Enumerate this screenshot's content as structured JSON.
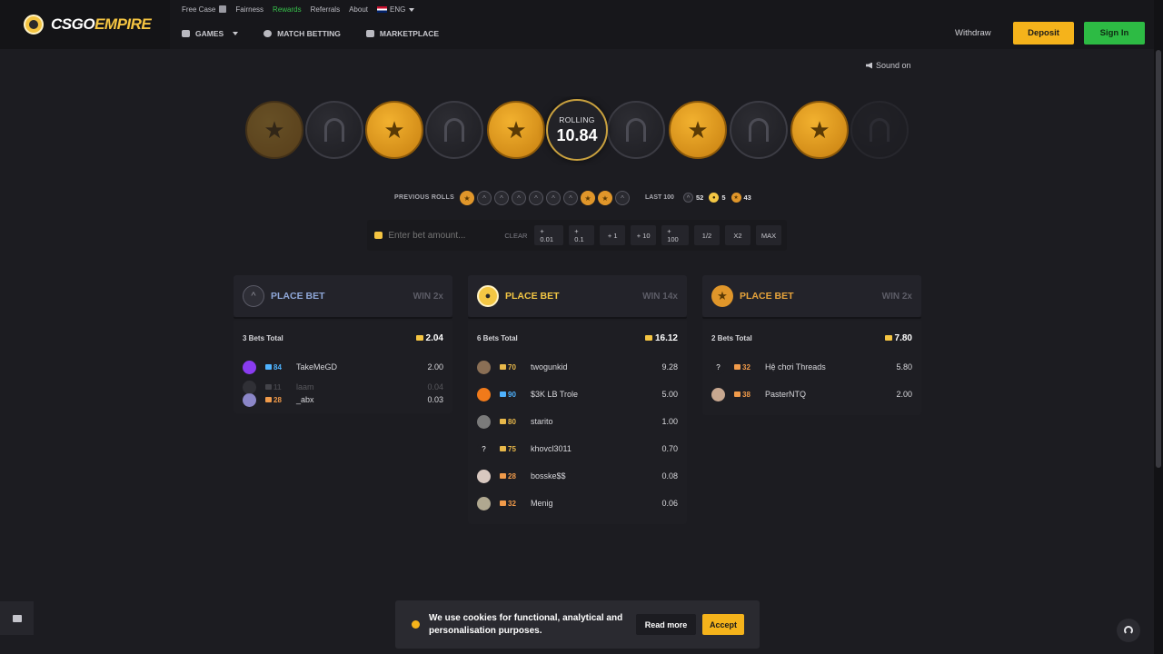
{
  "header": {
    "logo_white": "CSGO",
    "logo_yellow": "EMPIRE",
    "top_links": [
      "Free Case",
      "Fairness",
      "Rewards",
      "Referrals",
      "About"
    ],
    "language": "ENG",
    "nav": [
      "GAMES",
      "MATCH BETTING",
      "MARKETPLACE"
    ],
    "withdraw": "Withdraw",
    "deposit": "Deposit",
    "sign_in": "Sign In"
  },
  "sound": "Sound on",
  "roulette": {
    "label": "ROLLING",
    "value": "10.84",
    "strip": [
      "t",
      "ct",
      "t",
      "ct",
      "t",
      "rolling",
      "ct",
      "t",
      "ct",
      "t",
      "ct"
    ]
  },
  "previous_rolls": {
    "label": "PREVIOUS ROLLS",
    "items": [
      "t",
      "ct",
      "ct",
      "ct",
      "ct",
      "ct",
      "ct",
      "t",
      "t",
      "ct"
    ]
  },
  "last100": {
    "label": "LAST 100",
    "ct": "52",
    "bonus": "5",
    "t": "43"
  },
  "bet_input": {
    "placeholder": "Enter bet amount...",
    "clear": "CLEAR",
    "chips": [
      "+ 0.01",
      "+ 0.1",
      "+ 1",
      "+ 10",
      "+ 100",
      "1/2",
      "X2",
      "MAX"
    ]
  },
  "columns": [
    {
      "type": "ct",
      "place": "PLACE BET",
      "win": "WIN 2x",
      "total_label": "3 Bets Total",
      "total": "2.04",
      "players": [
        {
          "level": "84",
          "name": "TakeMeGD",
          "amount": "2.00",
          "state": "normal",
          "avatar": "#8a3cf0",
          "level_color": "#4fb3ff"
        },
        {
          "level": "11",
          "name": "laam",
          "amount": "0.04",
          "state": "fade",
          "avatar": "#5a5a62",
          "level_color": "#9a9aa2"
        },
        {
          "level": "28",
          "name": "_abx",
          "amount": "0.03",
          "state": "tight",
          "avatar": "#8b86c8",
          "level_color": "#f09a4a"
        }
      ]
    },
    {
      "type": "bonus",
      "place": "PLACE BET",
      "win": "WIN 14x",
      "total_label": "6 Bets Total",
      "total": "16.12",
      "players": [
        {
          "level": "70",
          "name": "twogunkid",
          "amount": "9.28",
          "state": "normal",
          "avatar": "#8a6f55",
          "level_color": "#e8b84a"
        },
        {
          "level": "90",
          "name": "$3K LB Trole",
          "amount": "5.00",
          "state": "normal",
          "avatar": "#f07a1a",
          "level_color": "#4fb3ff"
        },
        {
          "level": "80",
          "name": "starito",
          "amount": "1.00",
          "state": "normal",
          "avatar": "#7a7a7a",
          "level_color": "#e8b84a"
        },
        {
          "level": "75",
          "name": "khovcl3011",
          "amount": "0.70",
          "state": "normal",
          "avatar": "#1e1e23",
          "level_color": "#e8b84a"
        },
        {
          "level": "28",
          "name": "bosske$$",
          "amount": "0.08",
          "state": "normal",
          "avatar": "#d8c8c0",
          "level_color": "#f09a4a"
        },
        {
          "level": "32",
          "name": "Menig",
          "amount": "0.06",
          "state": "normal",
          "avatar": "#b0a890",
          "level_color": "#f09a4a"
        }
      ]
    },
    {
      "type": "t",
      "place": "PLACE BET",
      "win": "WIN 2x",
      "total_label": "2 Bets Total",
      "total": "7.80",
      "players": [
        {
          "level": "32",
          "name": "Hệ chơi Threads",
          "amount": "5.80",
          "state": "normal",
          "avatar": "#1e1e23",
          "level_color": "#f09a4a"
        },
        {
          "level": "38",
          "name": "PasterNTQ",
          "amount": "2.00",
          "state": "normal",
          "avatar": "#c8a890",
          "level_color": "#f09a4a"
        }
      ]
    }
  ],
  "cookie": {
    "text": "We use cookies for functional, analytical and personalisation purposes.",
    "read_more": "Read more",
    "accept": "Accept"
  },
  "colors": {
    "accent_yellow": "#f5b31b",
    "accent_green": "#2dbb44",
    "t_orange": "#e0962a",
    "ct_grey": "#2a2a30"
  }
}
